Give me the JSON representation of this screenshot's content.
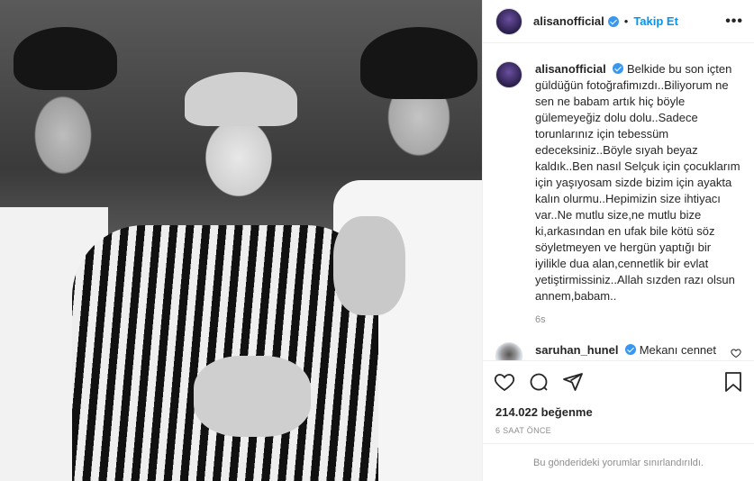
{
  "post": {
    "username": "alisanofficial",
    "follow_label": "Takip Et",
    "more_label": "•••",
    "separator": "•"
  },
  "caption": {
    "username": "alisanofficial",
    "text": "Belkide bu son içten güldüğün fotoğrafimızdı..Biliyorum ne sen ne babam artık hiç böyle gülemeyeğiz dolu dolu..Sadece torunlarınız için tebessüm edeceksiniz..Böyle sıyah beyaz kaldık..Ben nasıl Selçuk için çocuklarım için yaşıyosam sizde bizim için ayakta kalın olurmu..Hepimizin size ihtiyacı var..Ne mutlu size,ne mutlu bize ki,arkasından en ufak bile kötü söz söyletmeyen ve hergün yaptığı bir iyilikle dua alan,cennetlik bir evlat yetiştirmissiniz..Allah sızden razı olsun annem,babam..",
    "age": "6s"
  },
  "comments": [
    {
      "username": "saruhan_hunel",
      "text": "Mekanı cennet olsun Rabbim ailene ve sana sabırlar versin"
    }
  ],
  "likes_label": "214.022 beğenme",
  "timestamp": "6 SAAT ÖNCE",
  "comments_limited": "Bu gönderideki yorumlar sınırlandırıldı.",
  "colors": {
    "link_blue": "#0095f6",
    "verified_blue": "#3897f0",
    "muted": "#8e8e8e"
  },
  "icons": [
    "heart-icon",
    "comment-icon",
    "share-icon",
    "bookmark-icon",
    "verified-icon",
    "more-icon"
  ]
}
